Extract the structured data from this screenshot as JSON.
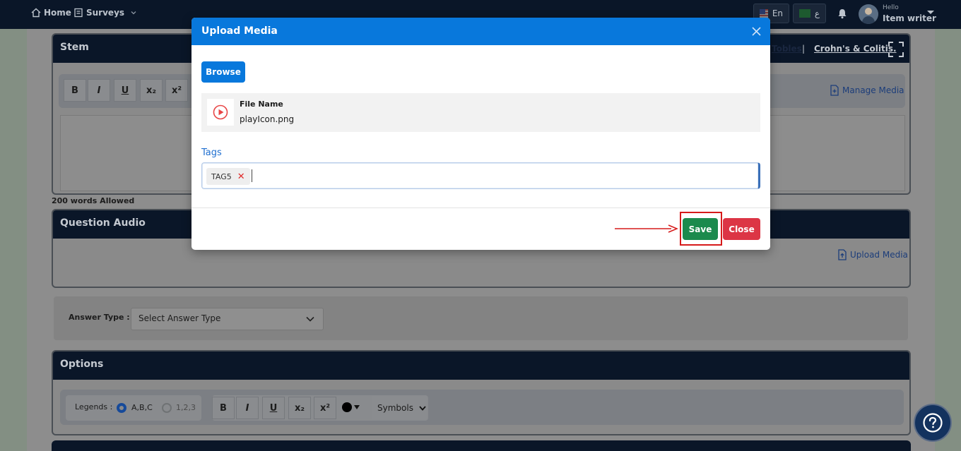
{
  "topbar": {
    "home_label": "Home",
    "surveys_label": "Surveys",
    "lang_en_label": "En",
    "lang_ar_label": "ع",
    "greeting": "Hello",
    "user_name": "Item writer"
  },
  "stem_card": {
    "title": "Stem",
    "links": [
      "Tobles",
      "Crohn's & Colitis."
    ],
    "separator": "|",
    "toolbar": [
      "B",
      "I",
      "U",
      "x₂",
      "x²"
    ],
    "manage_media_label": "Manage Media",
    "word_limit": "200 words Allowed"
  },
  "audio_card": {
    "title": "Question Audio",
    "upload_label": "Upload Media"
  },
  "answer_type": {
    "label": "Answer Type :",
    "placeholder": "Select Answer Type"
  },
  "options_card": {
    "title": "Options",
    "legends_label": "Legends :",
    "legend_options": [
      "A,B,C",
      "1,2,3"
    ],
    "toolbar": [
      "B",
      "I",
      "U",
      "x₂",
      "x²"
    ],
    "symbols_label": "Symbols"
  },
  "modal": {
    "title": "Upload Media",
    "browse_label": "Browse",
    "file_label": "File Name",
    "file_name": "playIcon.png",
    "tags_label": "Tags",
    "tags": [
      "TAG5"
    ],
    "save_label": "Save",
    "close_label": "Close"
  },
  "colors": {
    "modal_header": "#0878dc",
    "save": "#1b8a4d",
    "close": "#dc3545",
    "annotation": "#d61a1a"
  }
}
